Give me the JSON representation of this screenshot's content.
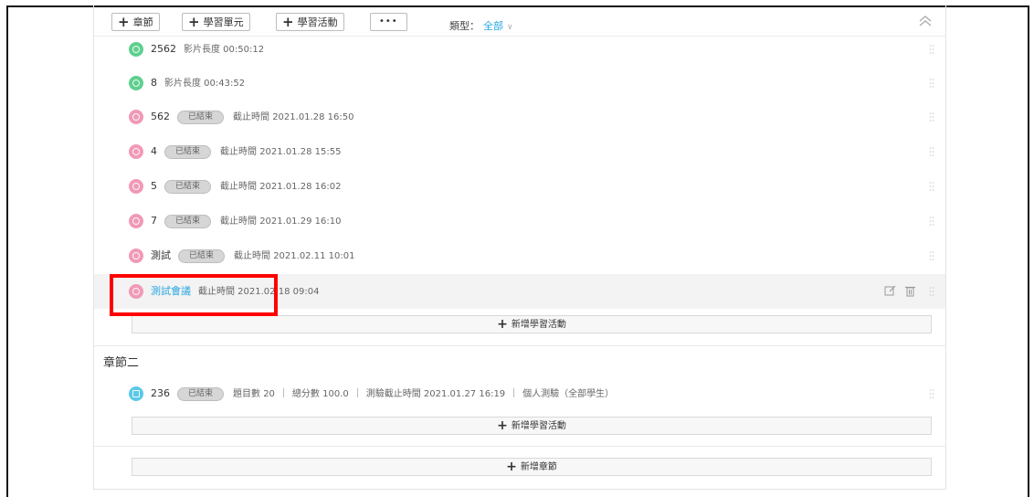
{
  "toolbar": {
    "add_chapter": "章節",
    "add_unit": "學習單元",
    "add_activity": "學習活動",
    "more": "•••",
    "filter_label": "類型：",
    "filter_value": "全部"
  },
  "items": [
    {
      "title": "2562",
      "meta": "影片長度 00:50:12",
      "badge": "",
      "icon": "video-icon",
      "color": "#5fcf8f"
    },
    {
      "title": "8",
      "meta": "影片長度 00:43:52",
      "badge": "",
      "icon": "video-icon",
      "color": "#5fcf8f"
    },
    {
      "title": "562",
      "meta": "截止時間 2021.01.28 16:50",
      "badge": "已結束",
      "icon": "discussion-icon",
      "color": "#f09ab6"
    },
    {
      "title": "4",
      "meta": "截止時間 2021.01.28 15:55",
      "badge": "已結束",
      "icon": "discussion-icon",
      "color": "#f09ab6"
    },
    {
      "title": "5",
      "meta": "截止時間 2021.01.28 16:02",
      "badge": "已結束",
      "icon": "discussion-icon",
      "color": "#f09ab6"
    },
    {
      "title": "7",
      "meta": "截止時間 2021.01.29 16:10",
      "badge": "已結束",
      "icon": "discussion-icon",
      "color": "#f09ab6"
    },
    {
      "title": "測試",
      "meta": "截止時間 2021.02.11 10:01",
      "badge": "已結束",
      "icon": "discussion-icon",
      "color": "#f09ab6"
    },
    {
      "title": "測試會議",
      "meta": "截止時間 2021.02.18 09:04",
      "badge": "",
      "icon": "discussion-icon",
      "color": "#f09ab6"
    }
  ],
  "add_activity_label": "新增學習活動",
  "chapter2": {
    "title": "章節二",
    "quiz": {
      "title": "236",
      "badge": "已結束",
      "count": "題目數 20",
      "score": "總分數 100.0",
      "deadline": "測驗截止時間 2021.01.27 16:19",
      "mode": "個人測驗（全部學生）",
      "color": "#5bc8e8"
    },
    "add_activity_label": "新增學習活動"
  },
  "add_chapter_label": "新增章節"
}
